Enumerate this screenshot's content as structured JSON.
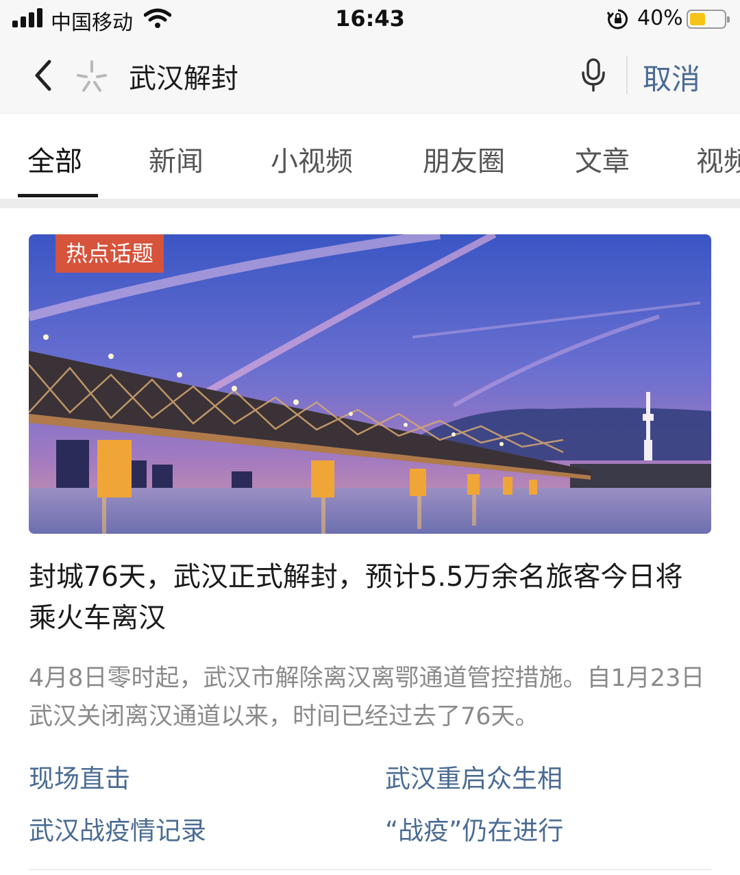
{
  "status_bar": {
    "carrier": "中国移动",
    "time": "16:43",
    "battery_percent": "40%",
    "battery_level": 0.4,
    "battery_color": "#f6c418"
  },
  "search": {
    "back_icon": "chevron-left-icon",
    "brand_icon": "spark-icon",
    "query": "武汉解封",
    "mic_icon": "microphone-icon",
    "cancel_label": "取消"
  },
  "tabs": [
    {
      "label": "全部",
      "active": true
    },
    {
      "label": "新闻",
      "active": false
    },
    {
      "label": "小视频",
      "active": false
    },
    {
      "label": "朋友圈",
      "active": false
    },
    {
      "label": "文章",
      "active": false
    },
    {
      "label": "视频",
      "active": false
    }
  ],
  "card": {
    "badge": "热点话题",
    "badge_color": "#d6533c",
    "headline": "封城76天，武汉正式解封，预计5.5万余名旅客今日将乘火车离汉",
    "summary": "4月8日零时起，武汉市解除离汉离鄂通道管控措施。自1月23日武汉关闭离汉通道以来，时间已经过去了76天。",
    "links": [
      "现场直击",
      "武汉重启众生相",
      "武汉战疫情记录",
      "“战疫”仍在进行"
    ],
    "link_color": "#4a6b94"
  }
}
